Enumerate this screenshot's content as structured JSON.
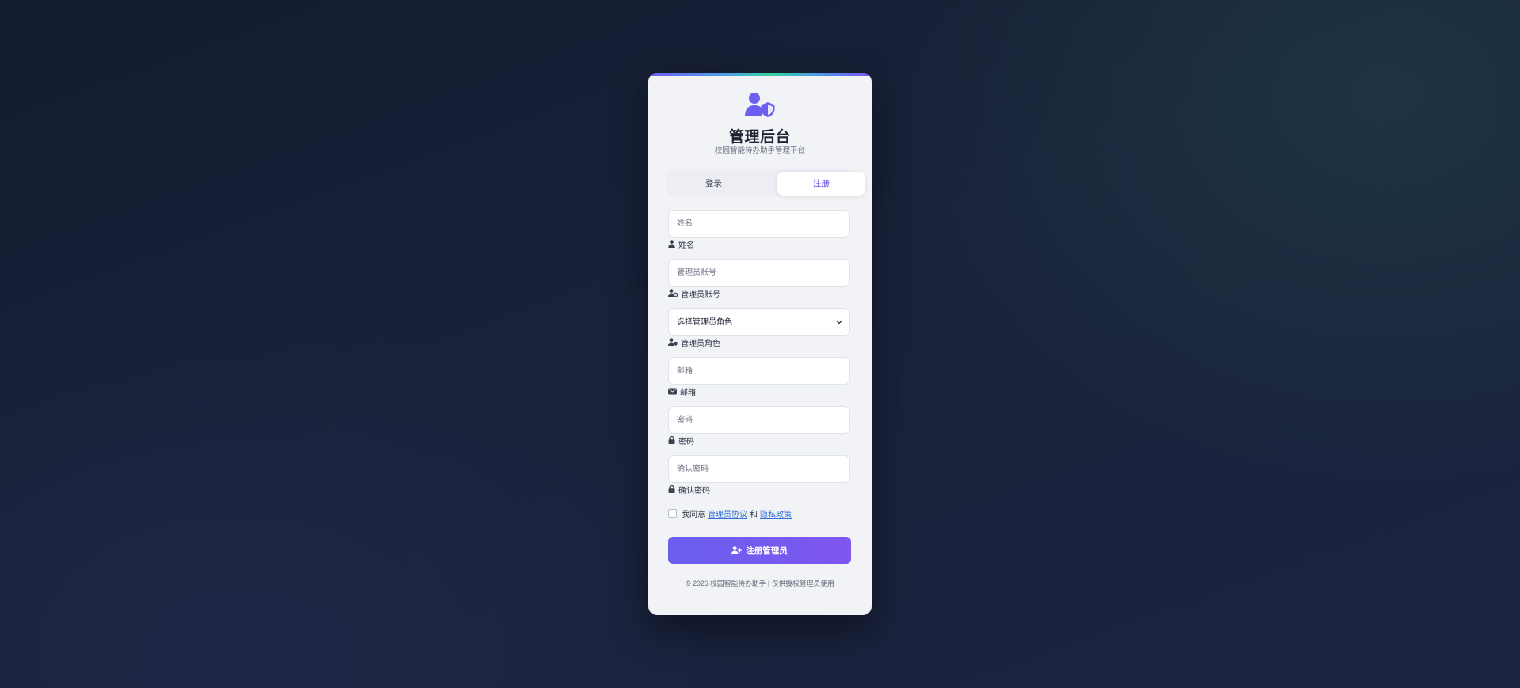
{
  "header": {
    "title": "管理后台",
    "subtitle": "校园智能待办助手管理平台",
    "logo_icon": "user-shield-icon"
  },
  "tabs": [
    {
      "label": "登录",
      "active": false
    },
    {
      "label": "注册",
      "active": true
    }
  ],
  "form": {
    "name": {
      "placeholder": "姓名",
      "label": "姓名",
      "icon": "user-icon"
    },
    "account": {
      "placeholder": "管理员账号",
      "label": "管理员账号",
      "icon": "user-gear-icon"
    },
    "role": {
      "selected": "选择管理员角色",
      "label": "管理员角色",
      "icon": "user-tag-icon"
    },
    "email": {
      "placeholder": "邮箱",
      "label": "邮箱",
      "icon": "envelope-icon"
    },
    "password": {
      "placeholder": "密码",
      "label": "密码",
      "icon": "lock-icon"
    },
    "confirm_password": {
      "placeholder": "确认密码",
      "label": "确认密码",
      "icon": "lock-icon"
    }
  },
  "agreement": {
    "prefix": "我同意",
    "link1": "管理员协议",
    "conjunction": "和",
    "link2": "隐私政策",
    "checked": false
  },
  "submit": {
    "label": "注册管理员",
    "icon": "user-plus-icon"
  },
  "footer": {
    "text": "© 2026 校园智能待办助手 | 仅供授权管理员使用"
  },
  "colors": {
    "accent": "#6b5ff0",
    "card_bg": "#f1f3f6",
    "page_bg": "#161e33",
    "link": "#2f6fd6"
  }
}
